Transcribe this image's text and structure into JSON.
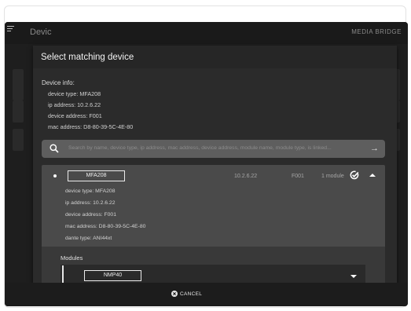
{
  "app": {
    "title": "Devic",
    "right_label": "MEDIA BRIDGE"
  },
  "dialog": {
    "title": "Select matching device",
    "info": {
      "heading": "Device info:",
      "lines": [
        "device type: MFA208",
        "ip address: 10.2.6.22",
        "device address: F001",
        "mac address: D8-80-39-5C-4E-80"
      ]
    },
    "search": {
      "placeholder": "Search by name, device type, ip address, mac address, device address, module name, module type, is linked..."
    },
    "device": {
      "name": "MFA208",
      "ip": "10.2.6.22",
      "address": "F001",
      "modules_count": "1 module",
      "details": [
        "device type: MFA208",
        "ip address: 10.2.6.22",
        "device address: F001",
        "mac address: D8-80-39-5C-4E-80",
        "dante type: ANI44xt"
      ],
      "modules": {
        "heading": "Modules",
        "items": [
          {
            "name": "NMP40"
          }
        ]
      }
    },
    "cancel_label": "CANCEL"
  },
  "icons": {
    "menu": "hamburger-icon",
    "search": "search-icon",
    "go": "arrow-right-icon",
    "check": "check-circle-icon",
    "collapse": "caret-up-icon",
    "expand": "caret-down-icon",
    "cancel": "close-circle-icon"
  },
  "colors": {
    "app_bg": "#1e1e1e",
    "dialog_bg": "#2b2b2b",
    "card_bg": "#4a4a4a",
    "search_bg": "#5e5e5e",
    "text": "#f2f2f2"
  }
}
